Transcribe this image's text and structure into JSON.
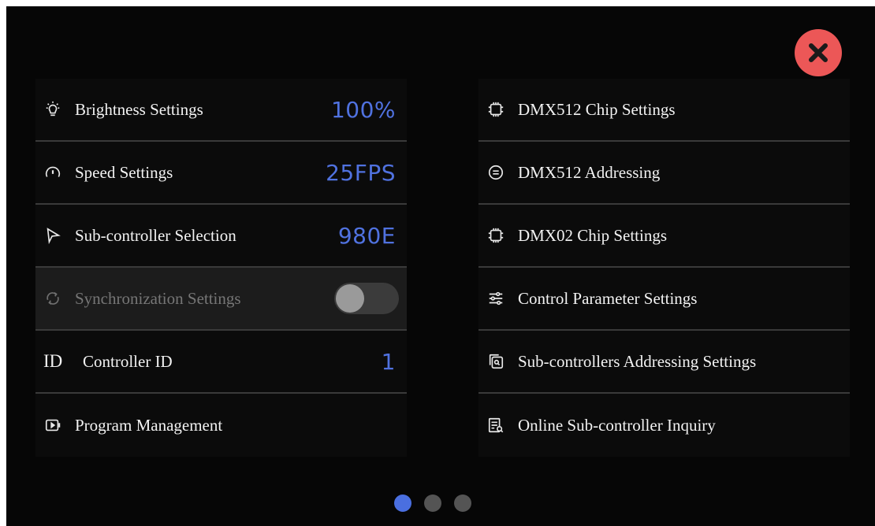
{
  "left_menu": [
    {
      "label": "Brightness Settings",
      "value": "100%",
      "icon": "bulb-icon"
    },
    {
      "label": "Speed Settings",
      "value": "25FPS",
      "icon": "speedometer-icon"
    },
    {
      "label": "Sub-controller Selection",
      "value": "980E",
      "icon": "cursor-icon"
    },
    {
      "label": "Synchronization Settings",
      "enabled": false,
      "icon": "sync-icon"
    },
    {
      "label": "Controller ID",
      "value": "1",
      "icon_text": "ID"
    },
    {
      "label": "Program Management",
      "icon": "play-icon"
    }
  ],
  "right_menu": [
    {
      "label": "DMX512 Chip Settings",
      "icon": "chip-icon"
    },
    {
      "label": "DMX512 Addressing",
      "icon": "address-icon"
    },
    {
      "label": "DMX02 Chip Settings",
      "icon": "chip-icon"
    },
    {
      "label": "Control Parameter Settings",
      "icon": "sliders-icon"
    },
    {
      "label": "Sub-controllers Addressing Settings",
      "icon": "search-copy-icon"
    },
    {
      "label": "Online Sub-controller Inquiry",
      "icon": "list-search-icon"
    }
  ],
  "pager": {
    "pages": 3,
    "current": 1
  },
  "colors": {
    "accent": "#4a6fe0",
    "close": "#ec5757",
    "value": "#5072e0"
  }
}
